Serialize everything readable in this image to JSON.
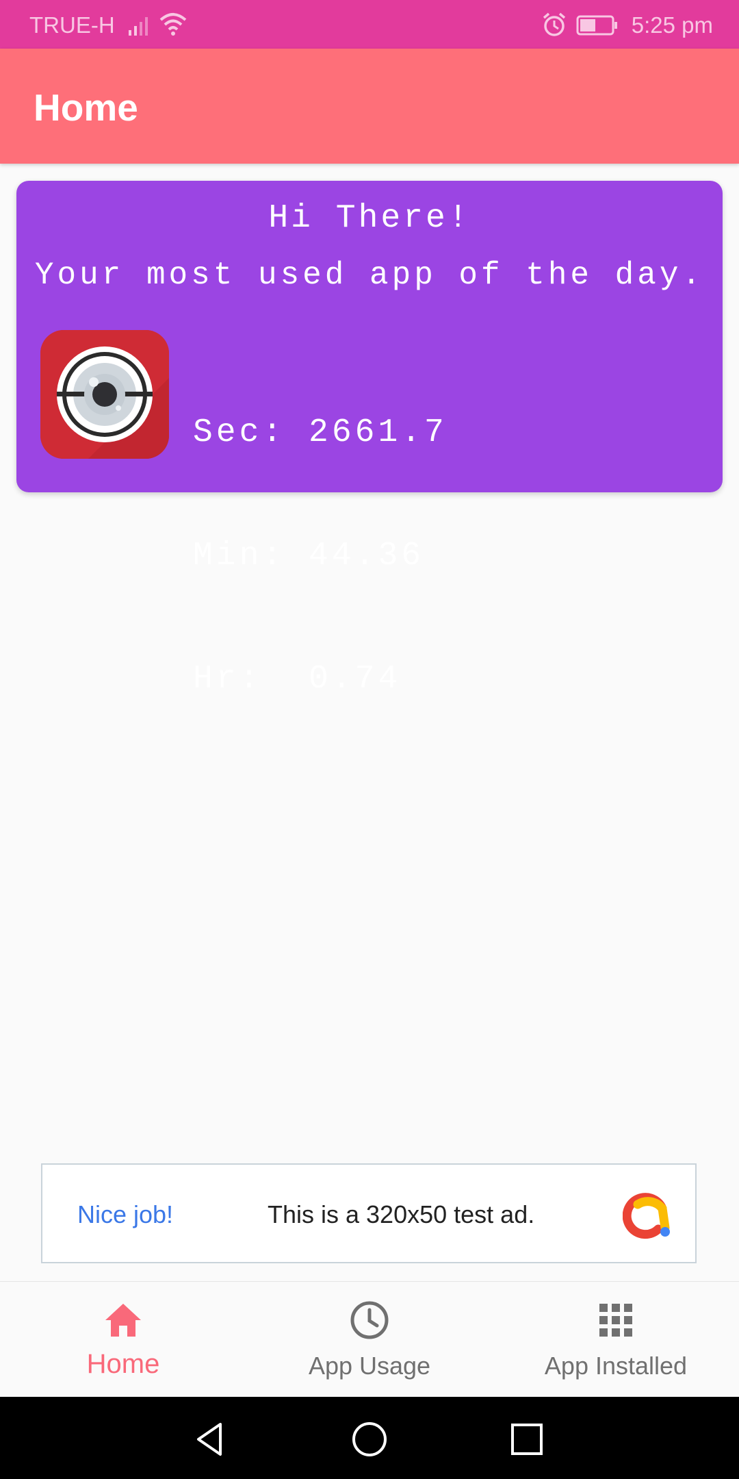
{
  "status_bar": {
    "carrier": "TRUE-H",
    "time": "5:25 pm",
    "icons": [
      "signal-icon",
      "wifi-icon",
      "alarm-icon",
      "battery-icon"
    ]
  },
  "app_bar": {
    "title": "Home"
  },
  "card": {
    "greeting": "Hi There!",
    "subtitle": "Your most used app of the day.",
    "app_icon": "camera-app-icon",
    "stats": {
      "sec": "Sec: 2661.7",
      "min": "Min: 44.36",
      "hr": "Hr:  0.74"
    },
    "background_color": "#9b45e3"
  },
  "ad": {
    "headline": "Nice job!",
    "text": "This is a 320x50 test ad.",
    "logo": "admob-logo-icon"
  },
  "bottom_nav": {
    "items": [
      {
        "label": "Home",
        "icon": "home-icon",
        "active": true
      },
      {
        "label": "App Usage",
        "icon": "clock-icon",
        "active": false
      },
      {
        "label": "App Installed",
        "icon": "grid-icon",
        "active": false
      }
    ]
  },
  "system_nav": {
    "buttons": [
      "back-icon",
      "home-circle-icon",
      "recents-icon"
    ]
  },
  "colors": {
    "status_bar": "#e23b9c",
    "app_bar": "#fe6f79",
    "accent": "#f9697a",
    "card": "#9b45e3"
  }
}
